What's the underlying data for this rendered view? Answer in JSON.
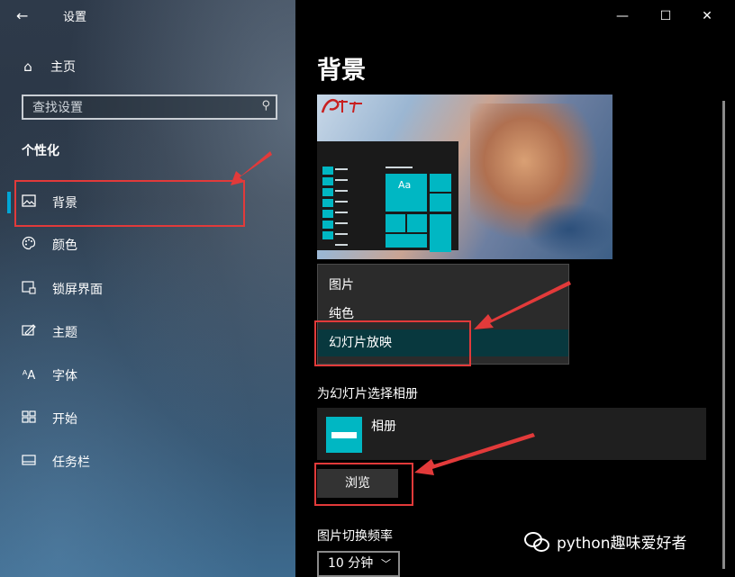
{
  "window": {
    "title": "设置",
    "back": "←",
    "minimize": "—",
    "maximize": "☐",
    "close": "✕"
  },
  "sidebar": {
    "home_label": "主页",
    "search_placeholder": "查找设置",
    "section": "个性化",
    "items": [
      {
        "label": "背景",
        "icon": "image-icon"
      },
      {
        "label": "颜色",
        "icon": "palette-icon"
      },
      {
        "label": "锁屏界面",
        "icon": "lock-screen-icon"
      },
      {
        "label": "主题",
        "icon": "theme-icon"
      },
      {
        "label": "字体",
        "icon": "font-icon"
      },
      {
        "label": "开始",
        "icon": "start-icon"
      },
      {
        "label": "任务栏",
        "icon": "taskbar-icon"
      }
    ]
  },
  "main": {
    "title": "背景",
    "preview_tile_text": "Aa",
    "dropdown": {
      "options": [
        "图片",
        "纯色",
        "幻灯片放映"
      ],
      "selected": "幻灯片放映"
    },
    "album_section_label": "为幻灯片选择相册",
    "album_name": "相册",
    "browse_label": "浏览",
    "freq_label": "图片切换频率",
    "freq_value": "10 分钟"
  },
  "watermark": "python趣味爱好者",
  "colors": {
    "accent": "#00b7c3",
    "highlight_red": "#e23a3a",
    "selected_row": "#08383e"
  }
}
